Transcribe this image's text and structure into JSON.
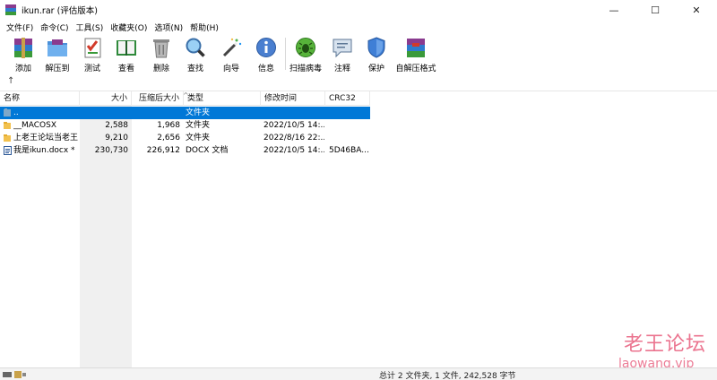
{
  "window": {
    "title": "ikun.rar (评估版本)",
    "minimize_glyph": "—",
    "maximize_glyph": "☐",
    "close_glyph": "✕"
  },
  "menu": [
    "文件(F)",
    "命令(C)",
    "工具(S)",
    "收藏夹(O)",
    "选项(N)",
    "帮助(H)"
  ],
  "toolbar": {
    "add": "添加",
    "extract_to": "解压到",
    "test": "测试",
    "view": "查看",
    "delete": "删除",
    "find": "查找",
    "wizard": "向导",
    "info": "信息",
    "virus_scan": "扫描病毒",
    "comment": "注释",
    "protect": "保护",
    "sfx": "自解压格式"
  },
  "up_glyph": "↑",
  "columns": {
    "name": "名称",
    "size": "大小",
    "packed": "压缩后大小",
    "type": "类型",
    "modified": "修改时间",
    "crc": "CRC32"
  },
  "files": [
    {
      "name": "..",
      "size": "",
      "packed": "",
      "type": "文件夹",
      "modified": "",
      "crc": "",
      "icon": "parent-folder-icon"
    },
    {
      "name": "__MACOSX",
      "size": "2,588",
      "packed": "1,968",
      "type": "文件夹",
      "modified": "2022/10/5 14:...",
      "crc": "",
      "icon": "folder-icon"
    },
    {
      "name": "上老王论坛当老王",
      "size": "9,210",
      "packed": "2,656",
      "type": "文件夹",
      "modified": "2022/8/16 22:...",
      "crc": "",
      "icon": "folder-icon"
    },
    {
      "name": "我是ikun.docx *",
      "size": "230,730",
      "packed": "226,912",
      "type": "DOCX 文档",
      "modified": "2022/10/5 14:...",
      "crc": "5D46BA...",
      "icon": "docx-icon"
    }
  ],
  "status": {
    "summary": "总计 2 文件夹, 1 文件, 242,528 字节"
  },
  "watermark": {
    "title": "老王论坛",
    "url": "laowang.vip"
  },
  "colors": {
    "selection": "#0078d7",
    "watermark": "#e85c7c",
    "folder": "#f2c14e"
  }
}
